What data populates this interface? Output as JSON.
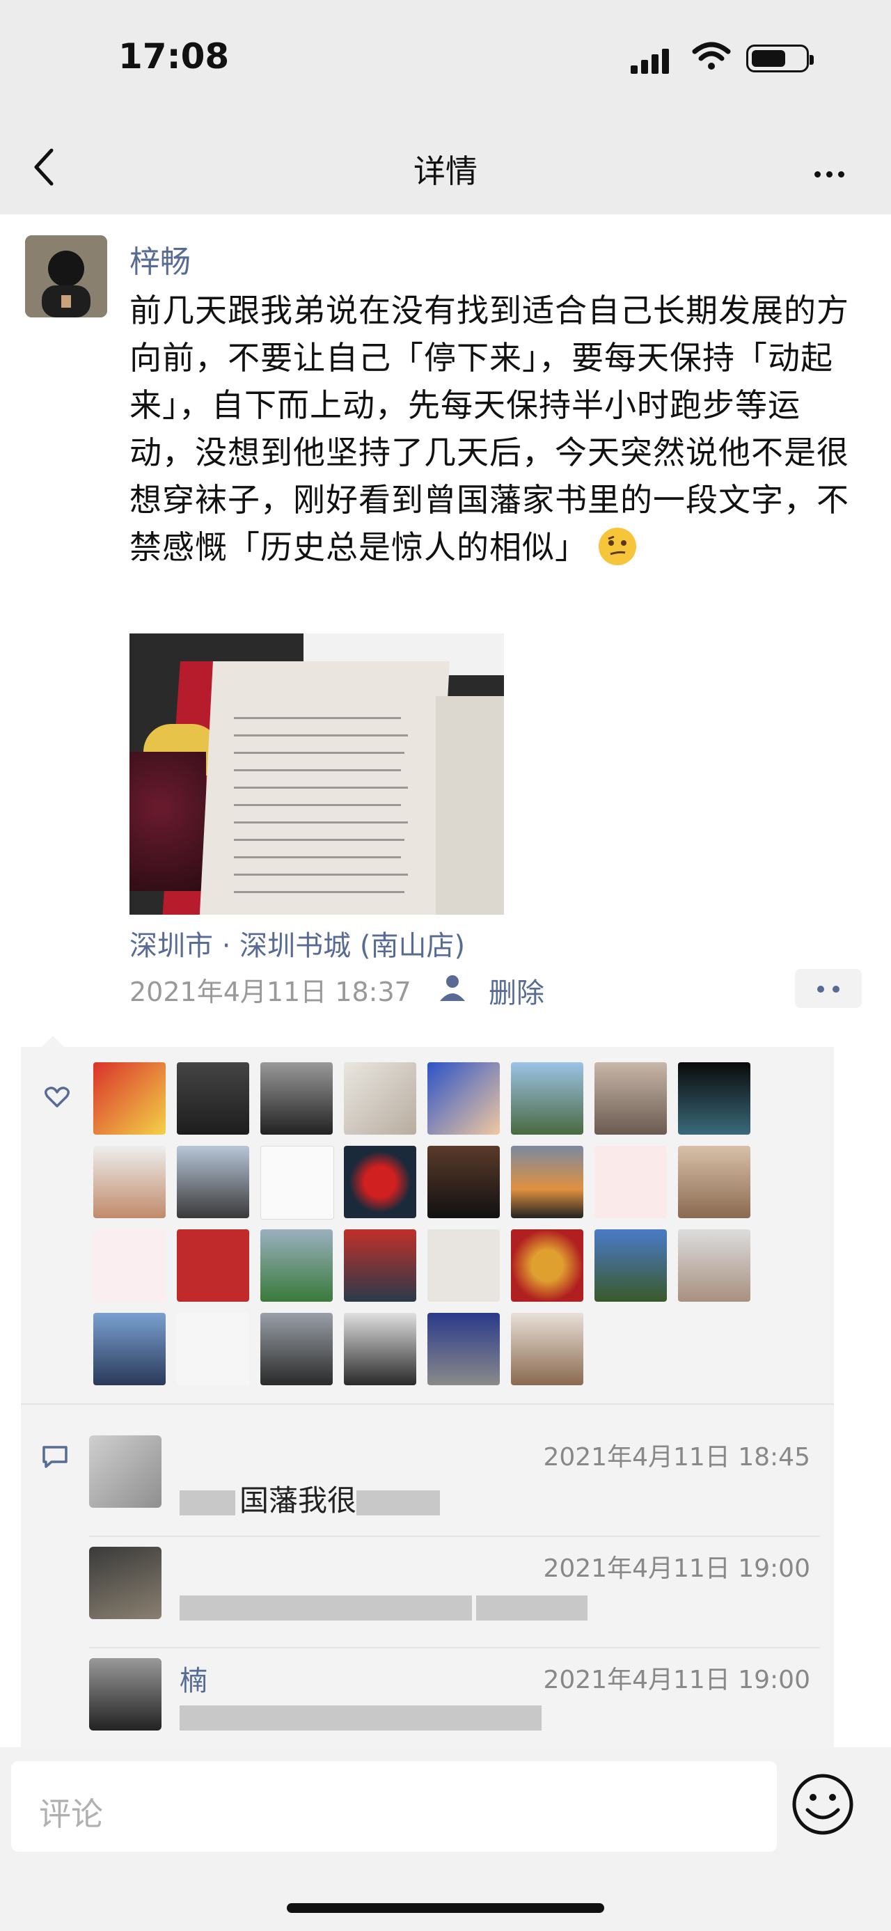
{
  "status_bar": {
    "time": "17:08"
  },
  "nav": {
    "title": "详情"
  },
  "post": {
    "author": "梓畅",
    "text": "前几天跟我弟说在没有找到适合自己长期发展的方向前，不要让自己「停下来」，要每天保持「动起来」，自下而上动，先每天保持半小时跑步等运动，没想到他坚持了几天后，今天突然说他不是很想穿袜子，刚好看到曾国藩家书里的一段文字，不禁感慨「历史总是惊人的相似」",
    "emoji": "smirk-emoji",
    "location": "深圳市 · 深圳书城 (南山店)",
    "time": "2021年4月11日 18:37",
    "delete_label": "删除"
  },
  "likes": {
    "icon": "heart-icon"
  },
  "comments": [
    {
      "name": "",
      "time": "2021年4月11日 18:45",
      "text": "国藩我很",
      "blurred": true
    },
    {
      "name": "",
      "time": "2021年4月11日 19:00",
      "text": "",
      "blurred": true
    },
    {
      "name": "楠",
      "time": "2021年4月11日 19:00",
      "text": "",
      "blurred": true
    }
  ],
  "comment_input": {
    "placeholder": "评论"
  },
  "colors": {
    "link": "#576b95",
    "panel": "#f3f3f3"
  }
}
